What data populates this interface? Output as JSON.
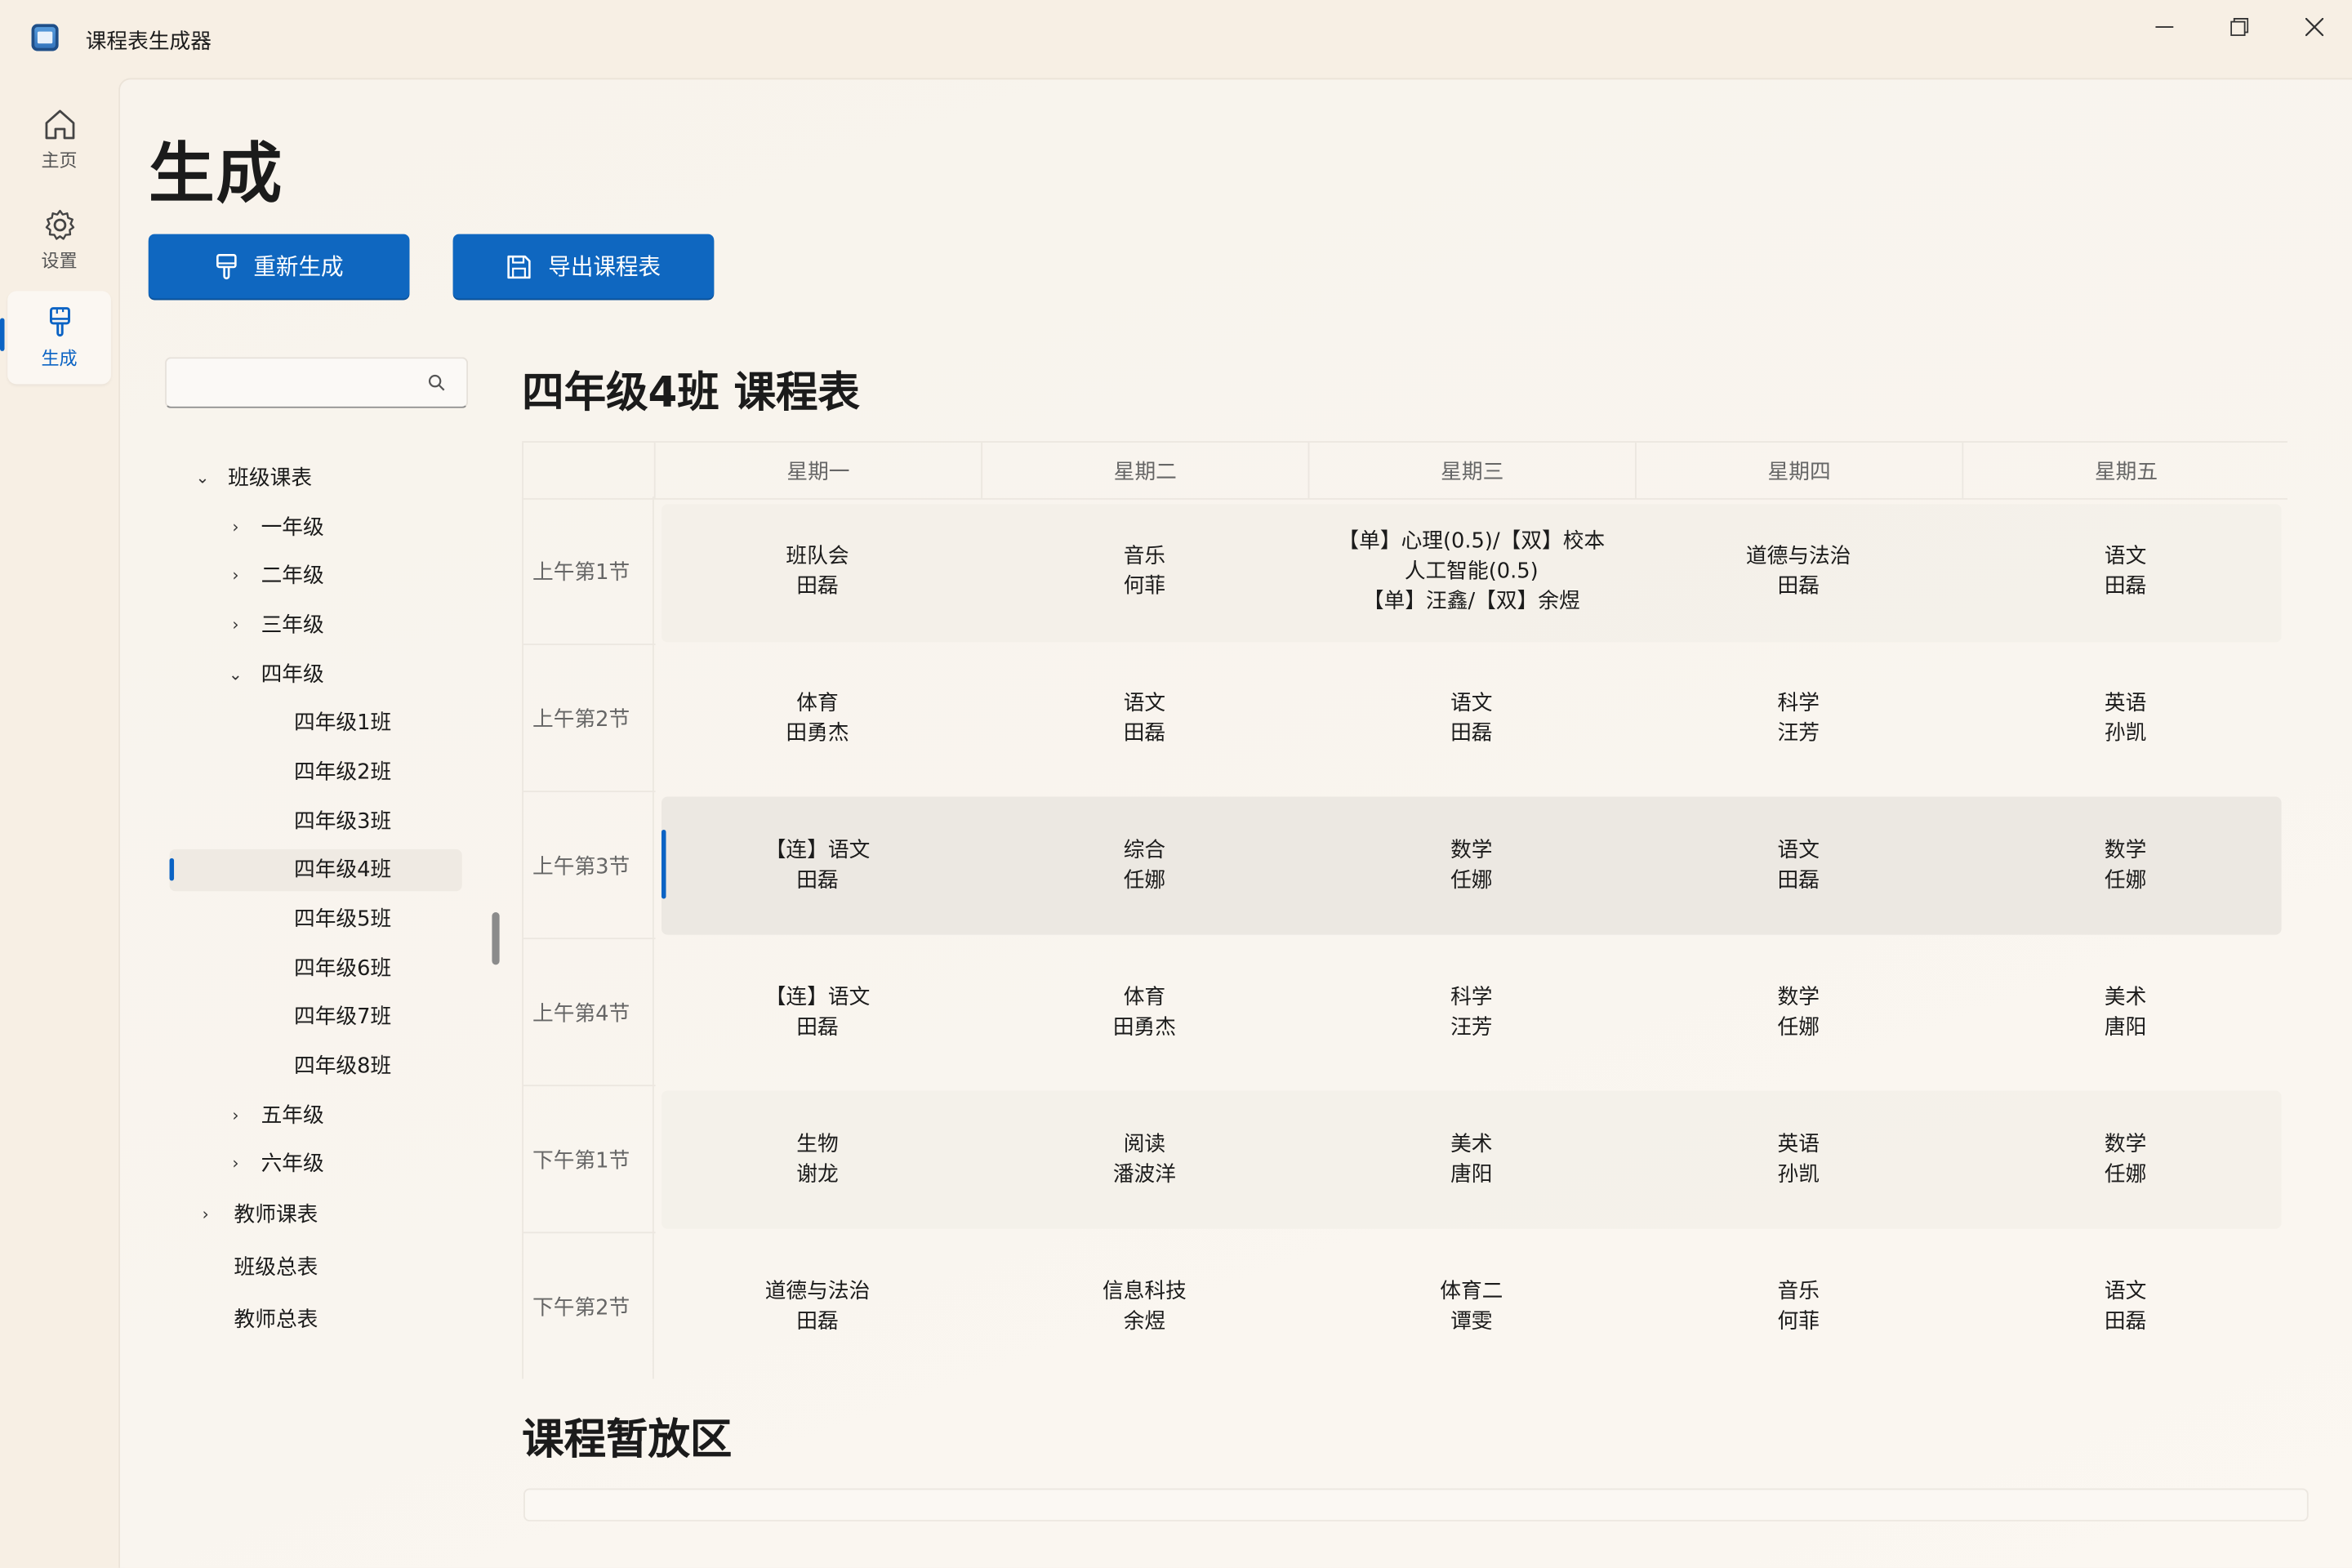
{
  "app": {
    "title": "课程表生成器",
    "minimize": "—",
    "maximize": "❐",
    "close": "✕"
  },
  "nav": [
    {
      "label": "主页",
      "icon": "home-icon"
    },
    {
      "label": "设置",
      "icon": "gear-icon"
    },
    {
      "label": "生成",
      "icon": "brush-icon",
      "active": true
    }
  ],
  "page": {
    "title": "生成"
  },
  "buttons": {
    "regenerate": "重新生成",
    "export": "导出课程表"
  },
  "search": {
    "placeholder": "",
    "value": ""
  },
  "tree": {
    "root_class": "班级课表",
    "grades": [
      "一年级",
      "二年级",
      "三年级",
      "四年级",
      "五年级",
      "六年级"
    ],
    "grade4_classes": [
      "四年级1班",
      "四年级2班",
      "四年级3班",
      "四年级4班",
      "四年级5班",
      "四年级6班",
      "四年级7班",
      "四年级8班"
    ],
    "teacher": "教师课表",
    "class_total": "班级总表",
    "teacher_total": "教师总表",
    "selected": "四年级4班"
  },
  "schedule": {
    "title": "四年级4班 课程表",
    "days": [
      "星期一",
      "星期二",
      "星期三",
      "星期四",
      "星期五"
    ],
    "periods": [
      "上午第1节",
      "上午第2节",
      "上午第3节",
      "上午第4节",
      "下午第1节",
      "下午第2节"
    ],
    "rows": [
      [
        [
          "班队会",
          "田磊"
        ],
        [
          "音乐",
          "何菲"
        ],
        [
          "【单】心理(0.5)/【双】校本",
          "人工智能(0.5)",
          "【单】汪鑫/【双】余煜"
        ],
        [
          "道德与法治",
          "田磊"
        ],
        [
          "语文",
          "田磊"
        ]
      ],
      [
        [
          "体育",
          "田勇杰"
        ],
        [
          "语文",
          "田磊"
        ],
        [
          "语文",
          "田磊"
        ],
        [
          "科学",
          "汪芳"
        ],
        [
          "英语",
          "孙凯"
        ]
      ],
      [
        [
          "【连】语文",
          "田磊"
        ],
        [
          "综合",
          "任娜"
        ],
        [
          "数学",
          "任娜"
        ],
        [
          "语文",
          "田磊"
        ],
        [
          "数学",
          "任娜"
        ]
      ],
      [
        [
          "【连】语文",
          "田磊"
        ],
        [
          "体育",
          "田勇杰"
        ],
        [
          "科学",
          "汪芳"
        ],
        [
          "数学",
          "任娜"
        ],
        [
          "美术",
          "唐阳"
        ]
      ],
      [
        [
          "生物",
          "谢龙"
        ],
        [
          "阅读",
          "潘波洋"
        ],
        [
          "美术",
          "唐阳"
        ],
        [
          "英语",
          "孙凯"
        ],
        [
          "数学",
          "任娜"
        ]
      ],
      [
        [
          "道德与法治",
          "田磊"
        ],
        [
          "信息科技",
          "余煜"
        ],
        [
          "体育二",
          "谭雯"
        ],
        [
          "音乐",
          "何菲"
        ],
        [
          "语文",
          "田磊"
        ]
      ]
    ]
  },
  "holding": {
    "title": "课程暂放区"
  },
  "colors": {
    "accent": "#0b63c4",
    "button": "#0f67c0"
  }
}
